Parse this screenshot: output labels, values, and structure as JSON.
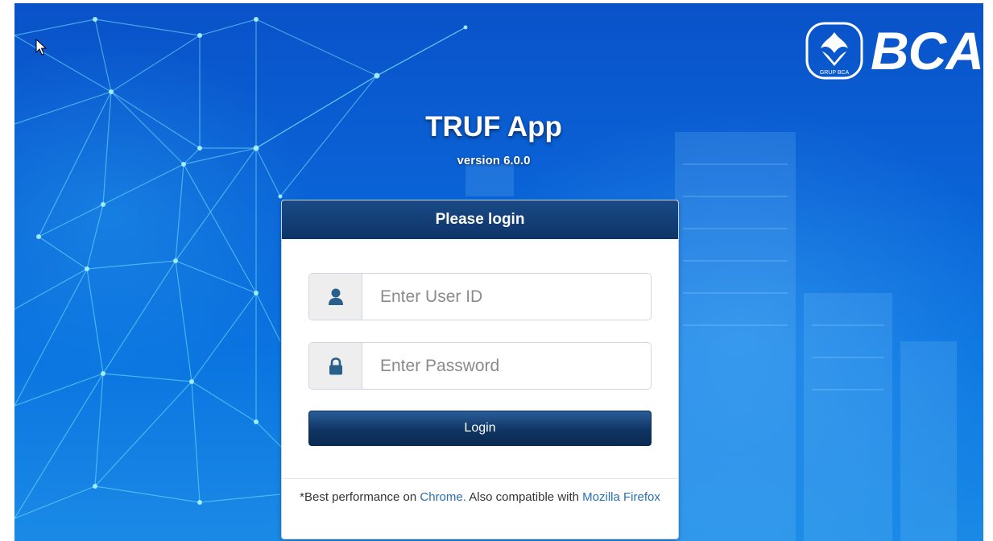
{
  "brand": {
    "logo_text": "BCA",
    "emblem_caption": "GRUP BCA",
    "icon": "bca-emblem-icon"
  },
  "app": {
    "title": "TRUF App",
    "version": "version 6.0.0"
  },
  "login_panel": {
    "heading": "Please login",
    "user_id": {
      "value": "",
      "placeholder": "Enter User ID",
      "icon": "user-icon"
    },
    "password": {
      "value": "",
      "placeholder": "Enter Password",
      "icon": "lock-icon"
    },
    "login_button": "Login",
    "note": {
      "prefix": "*Best performance on ",
      "chrome_link": "Chrome.",
      "middle": " Also compatible with ",
      "firefox_link": "Mozilla Firefox"
    }
  },
  "colors": {
    "background": "#0a63d6",
    "panel_header": "#0d3468",
    "button": "#0f3563",
    "link": "#2a6fb3"
  }
}
